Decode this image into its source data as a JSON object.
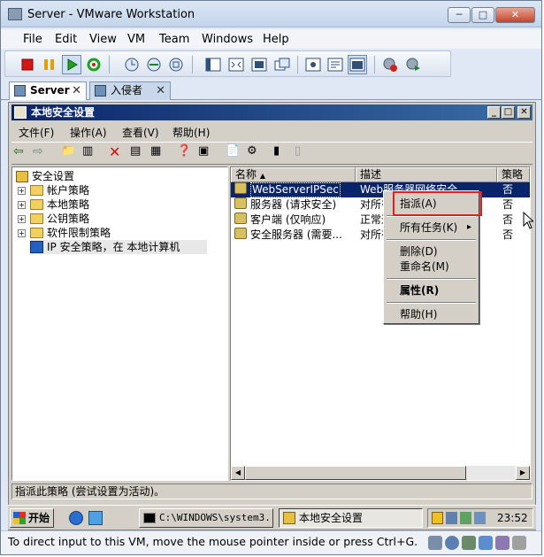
{
  "window": {
    "title": "Server - VMware Workstation"
  },
  "host_menu": [
    "File",
    "Edit",
    "View",
    "VM",
    "Team",
    "Windows",
    "Help"
  ],
  "tabs": [
    {
      "label": "Server"
    },
    {
      "label": "入侵者"
    }
  ],
  "mmc": {
    "title": "本地安全设置",
    "menu": [
      "文件(F)",
      "操作(A)",
      "查看(V)",
      "帮助(H)"
    ],
    "tree": {
      "root": "安全设置",
      "items": [
        "帐户策略",
        "本地策略",
        "公钥策略",
        "软件限制策略",
        "IP 安全策略，在 本地计算机"
      ]
    },
    "columns": [
      "名称",
      "描述",
      "策略"
    ],
    "rows": [
      {
        "name": "WebServerIPSec",
        "desc": "Web服务器网络安全",
        "policy": "否"
      },
      {
        "name": "服务器 (请求安全)",
        "desc": "对所有",
        "policy": "否"
      },
      {
        "name": "客户端 (仅响应)",
        "desc": "正常通",
        "policy": "否"
      },
      {
        "name": "安全服务器 (需要...",
        "desc": "对所有",
        "policy": "否"
      }
    ],
    "status": "指派此策略 (尝试设置为活动)。"
  },
  "context_menu": {
    "items": [
      "指派(A)",
      "所有任务(K)",
      "删除(D)",
      "重命名(M)",
      "属性(R)",
      "帮助(H)"
    ],
    "submenu_arrow": "▸"
  },
  "guest_taskbar": {
    "start": "开始",
    "tasks": [
      "C:\\WINDOWS\\system3...",
      "本地安全设置"
    ],
    "clock": "23:52"
  },
  "host_status": "To direct input to this VM, move the mouse pointer inside or press Ctrl+G.",
  "colors": {
    "selection": "#0a246a",
    "highlight_box": "#e02020",
    "title_gradient": "#0a246a"
  }
}
